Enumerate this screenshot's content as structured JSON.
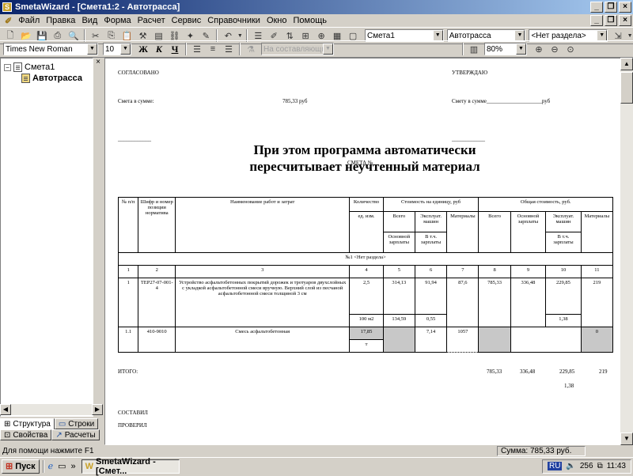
{
  "window": {
    "title": "SmetaWizard - [Смета1:2 - Автотрасса]"
  },
  "menu": [
    "Файл",
    "Правка",
    "Вид",
    "Форма",
    "Расчет",
    "Сервис",
    "Справочники",
    "Окно",
    "Помощь"
  ],
  "toolbar1": {
    "smeta_combo": "Смета1",
    "object_combo": "Автотрасса",
    "section_combo": "<Нет раздела>"
  },
  "toolbar2": {
    "font_combo": "Times New Roman",
    "size_combo": "10",
    "bold": "Ж",
    "italic": "К",
    "underline": "Ч",
    "composite_combo": "На составляющие",
    "zoom_combo": "80%"
  },
  "tree": {
    "root": "Смета1",
    "child": "Автотрасса"
  },
  "tabs": {
    "structure": "Структура",
    "rows": "Строки",
    "properties": "Свойства",
    "calculations": "Расчеты"
  },
  "document": {
    "agreed": "СОГЛАСОВАНО",
    "approve": "УТВЕРЖДАЮ",
    "sum_left_label": "Смета в сумме:",
    "sum_left_value": "785,33 руб",
    "sum_right": "Смету в сумме____________________руб",
    "sign_left": "____________",
    "sign_right": "____________",
    "overlay_title_1": "При этом программа автоматически",
    "overlay_title_2": "пересчитывает неучтенный материал",
    "smeta_no": "СМЕТА №",
    "headers": {
      "num": "№ п/п",
      "code": "Шифр и номер позиции норматива",
      "name": "Наименование работ и затрат",
      "qty": "Количество",
      "unit": "ед. изм.",
      "unit_cost": "Стоимость на единицу, руб",
      "total_cost": "Общая стоимость, руб.",
      "all": "Всего",
      "machines": "Эксплуат. машин",
      "materials": "Материалы",
      "base_salary": "Основной зарплаты",
      "incl_salary": "В т.ч. зарплаты",
      "main_salary": "Основной зарплаты"
    },
    "section_label": "№1 <Нет раздела>",
    "colnums": [
      "1",
      "2",
      "3",
      "4",
      "5",
      "6",
      "7",
      "8",
      "9",
      "10",
      "11"
    ],
    "row1": {
      "n": "1",
      "code": "ТЕР27-07-001-4",
      "name": "Устройство асфальтобетонных покрытий дорожек и тротуаров двухслойных с укладкой асфальтобетонной смеси вручную. Верхний слой из песчаной асфальтобетонной смеси толщиной 3 см",
      "qty": "2,5",
      "unit": "100 м2",
      "c5": "314,13",
      "c5b": "134,59",
      "c6": "91,94",
      "c6b": "0,55",
      "c7": "87,6",
      "c8": "785,33",
      "c9": "336,48",
      "c10": "229,85",
      "c10b": "1,38",
      "c11": "219"
    },
    "row2": {
      "n": "1.1",
      "code": "410-9010",
      "name": "Смесь асфальтобетонная",
      "qty": "17,85",
      "unit": "т",
      "c6": "7,14",
      "c7": "1057",
      "c11": "0"
    },
    "total": {
      "label": "ИТОГО:",
      "c8": "785,33",
      "c9": "336,48",
      "c10": "229,85",
      "c10b": "1,38",
      "c11": "219"
    },
    "composed": "СОСТАВИЛ",
    "checked": "ПРОВЕРИЛ"
  },
  "status": {
    "hint": "Для помощи нажмите F1",
    "sum": "Сумма: 785,33 руб."
  },
  "taskbar": {
    "start": "Пуск",
    "task": "SmetaWizard - [Смет...",
    "time": "11:43",
    "lang": "256"
  }
}
